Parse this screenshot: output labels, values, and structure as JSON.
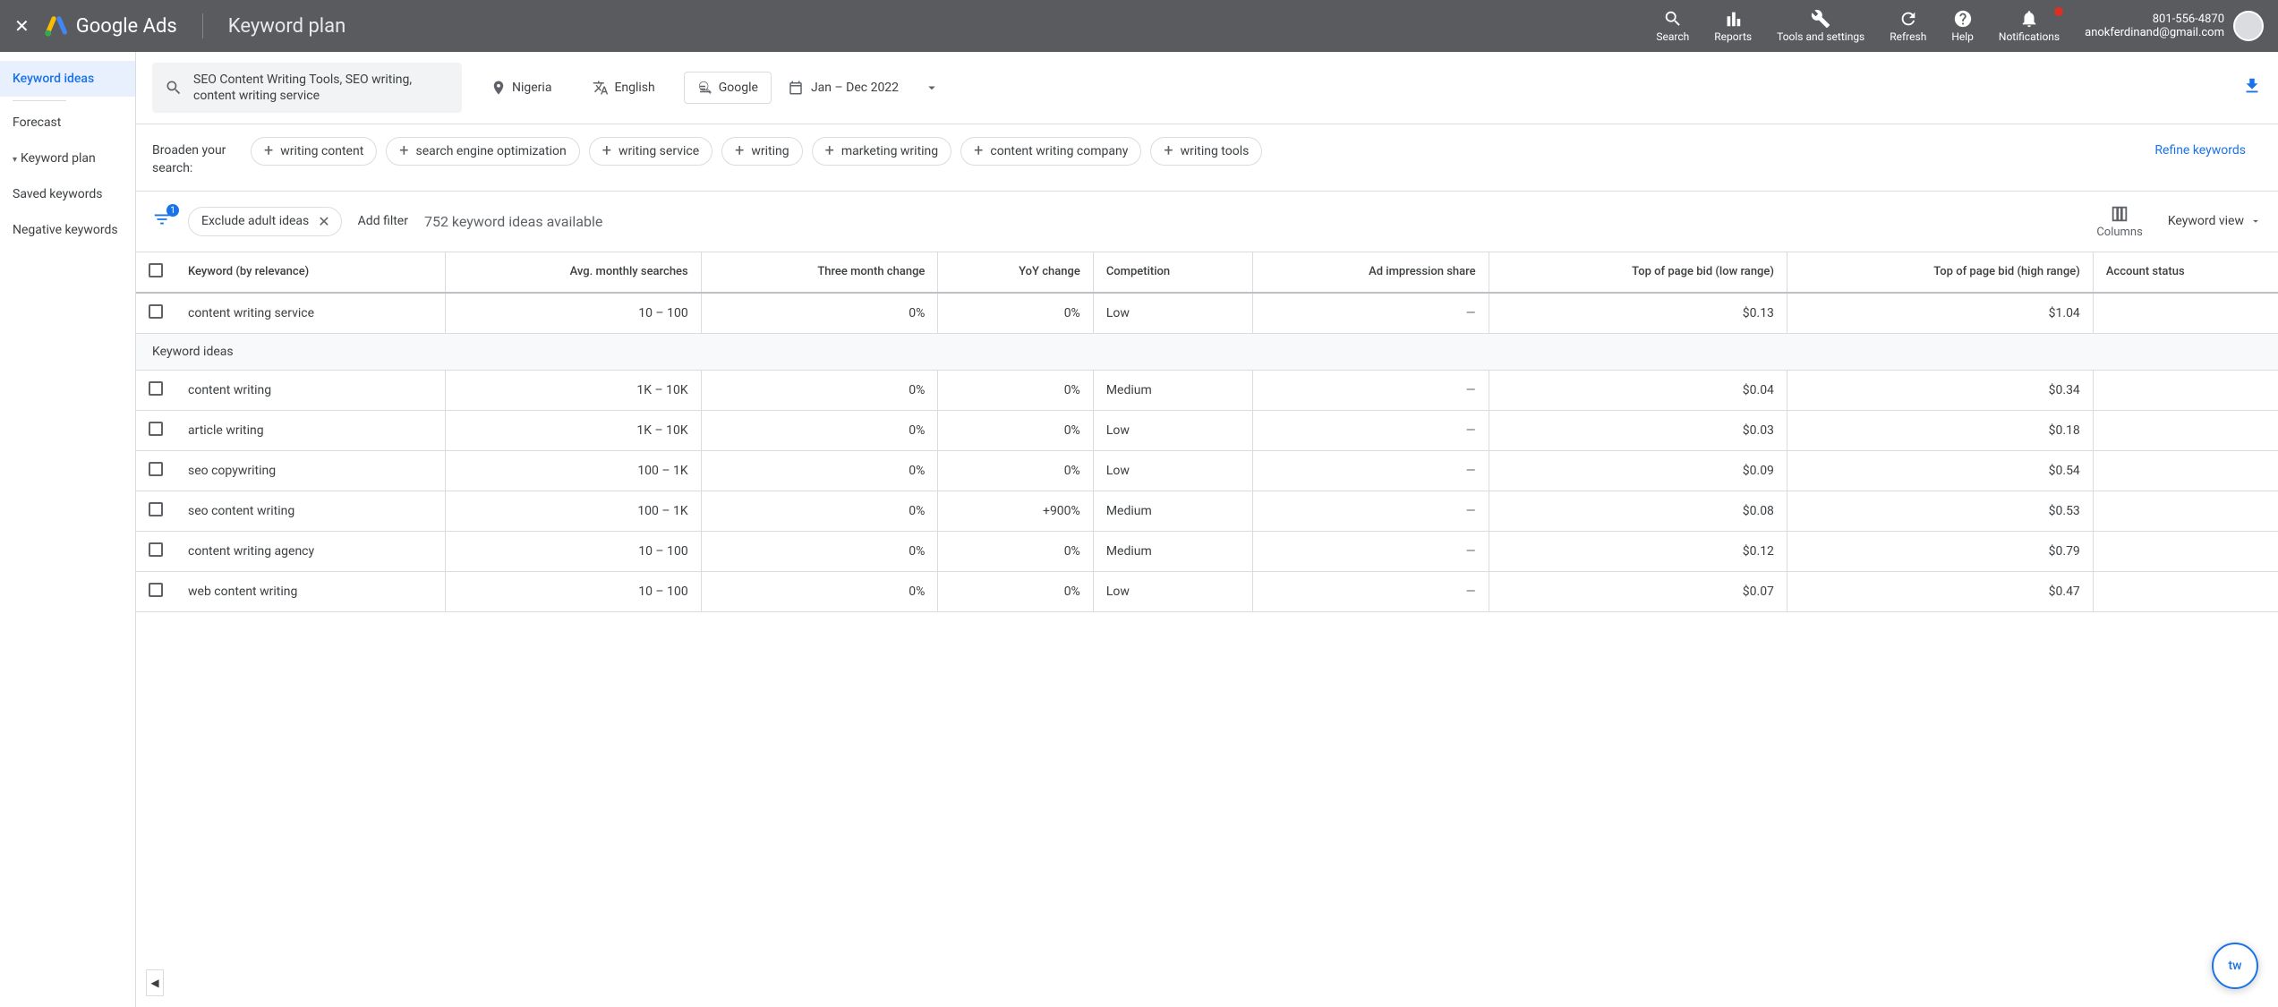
{
  "header": {
    "brand": "Google Ads",
    "page_title": "Keyword plan",
    "actions": {
      "search": "Search",
      "reports": "Reports",
      "tools": "Tools and settings",
      "refresh": "Refresh",
      "help": "Help",
      "notifications": "Notifications"
    },
    "account": {
      "phone": "801-556-4870",
      "email": "anokferdinand@gmail.com"
    }
  },
  "sidebar": {
    "items": [
      {
        "label": "Keyword ideas",
        "active": true
      },
      {
        "label": "Forecast"
      },
      {
        "label": "Keyword plan",
        "expandable": true
      },
      {
        "label": "Saved keywords"
      },
      {
        "label": "Negative keywords"
      }
    ]
  },
  "controls": {
    "search_text": "SEO Content Writing Tools, SEO writing, content writing service",
    "location": "Nigeria",
    "language": "English",
    "network": "Google",
    "date_range": "Jan – Dec 2022"
  },
  "broaden": {
    "label": "Broaden your search:",
    "chips": [
      "writing content",
      "search engine optimization",
      "writing service",
      "writing",
      "marketing writing",
      "content writing company",
      "writing tools"
    ],
    "refine": "Refine keywords"
  },
  "filters": {
    "badge": "1",
    "exclude_chip": "Exclude adult ideas",
    "add_filter": "Add filter",
    "ideas_count": "752 keyword ideas available",
    "columns_label": "Columns",
    "view_label": "Keyword view"
  },
  "table": {
    "headers": {
      "keyword": "Keyword (by relevance)",
      "avg_searches": "Avg. monthly searches",
      "three_month": "Three month change",
      "yoy": "YoY change",
      "competition": "Competition",
      "ad_impr": "Ad impression share",
      "bid_low": "Top of page bid (low range)",
      "bid_high": "Top of page bid (high range)",
      "account_status": "Account status"
    },
    "section_label": "Keyword ideas",
    "rows": [
      {
        "keyword": "content writing service",
        "searches": "10 – 100",
        "three_month": "0%",
        "yoy": "0%",
        "competition": "Low",
        "impr": "—",
        "low": "$0.13",
        "high": "$1.04",
        "status": ""
      },
      {
        "section": true
      },
      {
        "keyword": "content writing",
        "searches": "1K – 10K",
        "three_month": "0%",
        "yoy": "0%",
        "competition": "Medium",
        "impr": "—",
        "low": "$0.04",
        "high": "$0.34",
        "status": ""
      },
      {
        "keyword": "article writing",
        "searches": "1K – 10K",
        "three_month": "0%",
        "yoy": "0%",
        "competition": "Low",
        "impr": "—",
        "low": "$0.03",
        "high": "$0.18",
        "status": ""
      },
      {
        "keyword": "seo copywriting",
        "searches": "100 – 1K",
        "three_month": "0%",
        "yoy": "0%",
        "competition": "Low",
        "impr": "—",
        "low": "$0.09",
        "high": "$0.54",
        "status": ""
      },
      {
        "keyword": "seo content writing",
        "searches": "100 – 1K",
        "three_month": "0%",
        "yoy": "+900%",
        "competition": "Medium",
        "impr": "—",
        "low": "$0.08",
        "high": "$0.53",
        "status": ""
      },
      {
        "keyword": "content writing agency",
        "searches": "10 – 100",
        "three_month": "0%",
        "yoy": "0%",
        "competition": "Medium",
        "impr": "—",
        "low": "$0.12",
        "high": "$0.79",
        "status": ""
      },
      {
        "keyword": "web content writing",
        "searches": "10 – 100",
        "three_month": "0%",
        "yoy": "0%",
        "competition": "Low",
        "impr": "—",
        "low": "$0.07",
        "high": "$0.47",
        "status": ""
      }
    ]
  },
  "fab": "tw"
}
